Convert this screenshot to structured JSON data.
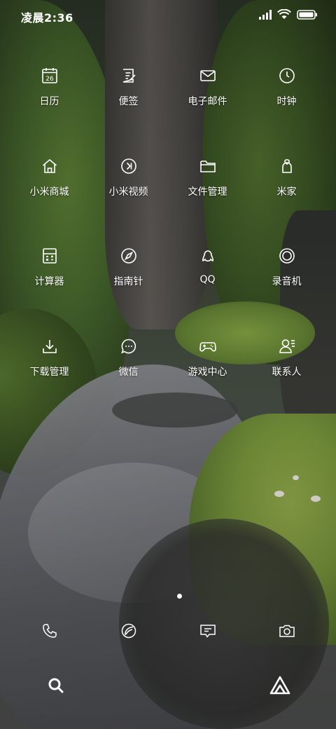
{
  "status_bar": {
    "time": "凌晨2:36",
    "icons": [
      "signal-icon",
      "wifi-icon",
      "battery-icon"
    ]
  },
  "apps": {
    "row1": [
      {
        "label": "日历",
        "icon": "calendar-icon",
        "icon_text": "26"
      },
      {
        "label": "便签",
        "icon": "notes-icon"
      },
      {
        "label": "电子邮件",
        "icon": "email-icon"
      },
      {
        "label": "时钟",
        "icon": "clock-icon"
      }
    ],
    "row2": [
      {
        "label": "小米商城",
        "icon": "store-icon"
      },
      {
        "label": "小米视频",
        "icon": "video-icon"
      },
      {
        "label": "文件管理",
        "icon": "folder-icon"
      },
      {
        "label": "米家",
        "icon": "mijia-icon"
      }
    ],
    "row3": [
      {
        "label": "计算器",
        "icon": "calculator-icon"
      },
      {
        "label": "指南针",
        "icon": "compass-icon"
      },
      {
        "label": "QQ",
        "icon": "qq-icon"
      },
      {
        "label": "录音机",
        "icon": "recorder-icon"
      }
    ],
    "row4": [
      {
        "label": "下载管理",
        "icon": "download-icon"
      },
      {
        "label": "微信",
        "icon": "wechat-icon"
      },
      {
        "label": "游戏中心",
        "icon": "gamepad-icon"
      },
      {
        "label": "联系人",
        "icon": "contacts-icon"
      }
    ]
  },
  "pager": {
    "current_page": 1,
    "total_pages": 1
  },
  "dock": [
    "phone-icon",
    "browser-icon",
    "messages-icon",
    "camera-icon"
  ],
  "bottom_bar": [
    "search-icon",
    "assistant-icon"
  ],
  "colors": {
    "icon": "#ffffff",
    "label": "#ffffff"
  }
}
